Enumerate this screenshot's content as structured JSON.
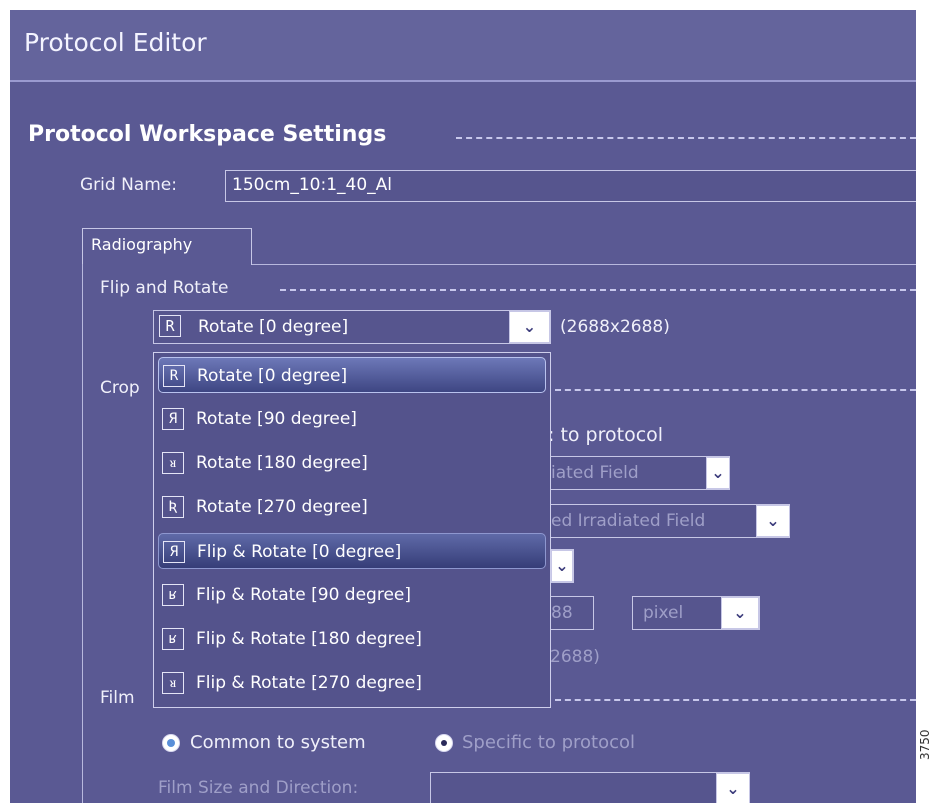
{
  "window": {
    "title": "Protocol Editor"
  },
  "section": {
    "title": "Protocol Workspace Settings"
  },
  "grid": {
    "label": "Grid Name:",
    "value": "150cm_10:1_40_Al"
  },
  "tabs": [
    {
      "label": "Radiography"
    }
  ],
  "flip_rotate": {
    "label": "Flip and Rotate",
    "selected_icon": "R",
    "selected": "Rotate [0 degree]",
    "resolution": "(2688x2688)",
    "options": [
      {
        "icon": "R",
        "label": "Rotate [0 degree]"
      },
      {
        "icon": "Я",
        "label": "Rotate [90 degree]"
      },
      {
        "icon": "ᴚ",
        "label": "Rotate [180 degree]"
      },
      {
        "icon": "Ʀ",
        "label": "Rotate [270 degree]"
      },
      {
        "icon": "Я",
        "label": "Flip & Rotate [0 degree]"
      },
      {
        "icon": "ʁ",
        "label": "Flip & Rotate [90 degree]"
      },
      {
        "icon": "ʁ",
        "label": "Flip & Rotate [180 degree]"
      },
      {
        "icon": "ᴚ",
        "label": "Flip & Rotate [270 degree]"
      }
    ]
  },
  "crop": {
    "label_partial": "Crop",
    "specific_partial": ": to protocol",
    "combo1_partial": "iated Field",
    "combo2_partial": "ed Irradiated Field",
    "value_partial": "88",
    "unit": "pixel",
    "dims_partial": "2688)"
  },
  "film": {
    "label_partial": "Film",
    "common": "Common to system",
    "specific": "Specific to protocol",
    "size_label": "Film Size and Direction:"
  },
  "side_number": "3750"
}
